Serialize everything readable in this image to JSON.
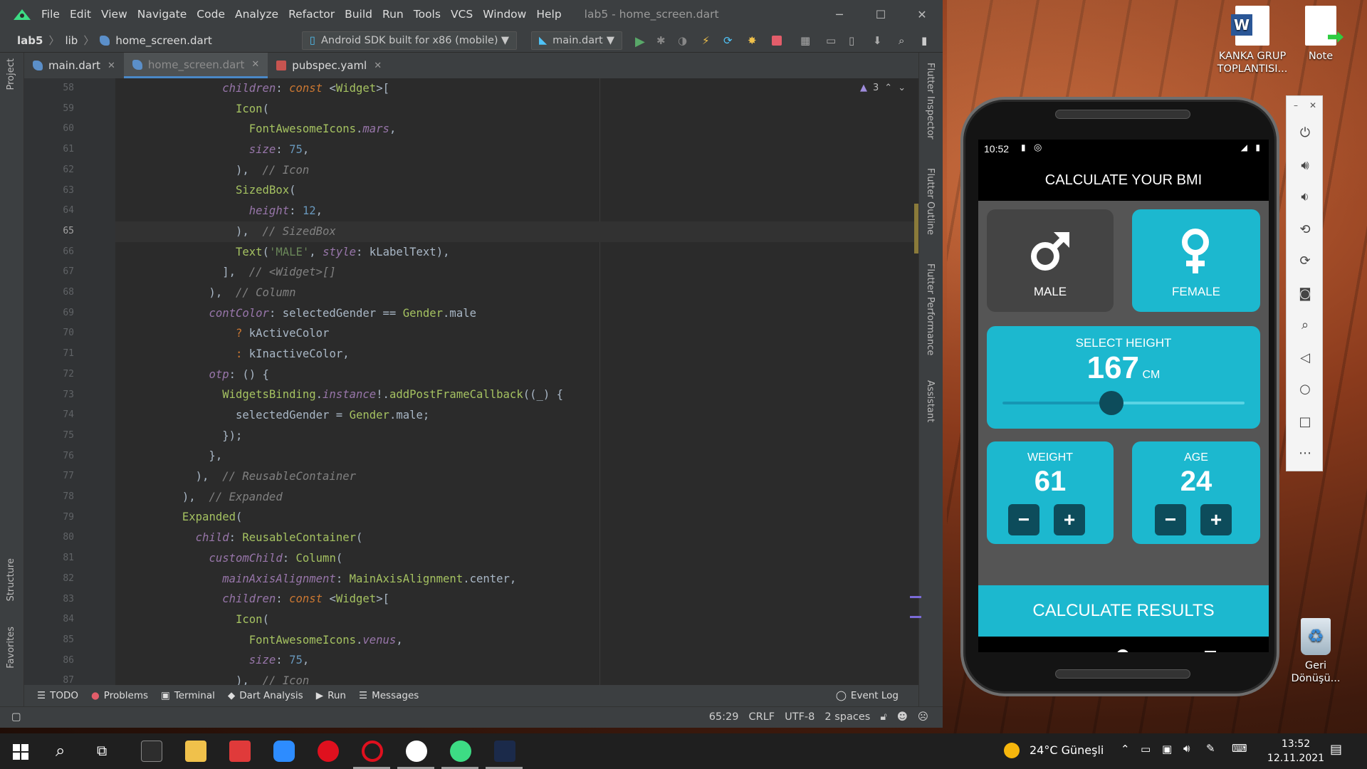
{
  "ide": {
    "menu": [
      "File",
      "Edit",
      "View",
      "Navigate",
      "Code",
      "Analyze",
      "Refactor",
      "Build",
      "Run",
      "Tools",
      "VCS",
      "Window",
      "Help"
    ],
    "window_title": "lab5 - home_screen.dart",
    "breadcrumb": [
      "lab5",
      "lib",
      "home_screen.dart"
    ],
    "device": "Android SDK built for x86 (mobile)",
    "run_config": "main.dart",
    "tabs": [
      {
        "label": "main.dart",
        "active": false
      },
      {
        "label": "home_screen.dart",
        "active": true
      },
      {
        "label": "pubspec.yaml",
        "active": false
      }
    ],
    "left_tabs": [
      "Project",
      "Structure",
      "Favorites"
    ],
    "right_tabs": [
      "Flutter Inspector",
      "Flutter Outline",
      "Flutter Performance",
      "Assistant"
    ],
    "warnings_count": "3",
    "line_numbers": [
      "58",
      "59",
      "60",
      "61",
      "62",
      "63",
      "64",
      "65",
      "66",
      "67",
      "68",
      "69",
      "70",
      "71",
      "72",
      "73",
      "74",
      "75",
      "76",
      "77",
      "78",
      "79",
      "80",
      "81",
      "82",
      "83",
      "84",
      "85",
      "86",
      "87"
    ],
    "current_line": "65",
    "bottom_tools": [
      "TODO",
      "Problems",
      "Terminal",
      "Dart Analysis",
      "Run",
      "Messages"
    ],
    "event_log": "Event Log",
    "status": {
      "position": "65:29",
      "line_sep": "CRLF",
      "encoding": "UTF-8",
      "indent": "2 spaces"
    }
  },
  "desktop": {
    "icons": [
      {
        "label": "KANKA GRUP TOPLANTISI...",
        "icon": "word-doc-icon"
      },
      {
        "label": "Note",
        "icon": "note-icon"
      },
      {
        "label": "Geri Dönüşü...",
        "icon": "recycle-bin-icon"
      }
    ]
  },
  "phone": {
    "time": "10:52",
    "app_title": "CALCULATE YOUR BMI",
    "male_label": "MALE",
    "female_label": "FEMALE",
    "height_label": "SELECT HEIGHT",
    "height_value": "167",
    "height_unit": "CM",
    "height_slider_fraction": 0.45,
    "weight_label": "WEIGHT",
    "weight_value": "61",
    "age_label": "AGE",
    "age_value": "24",
    "calc_label": "CALCULATE RESULTS",
    "colors": {
      "active": "#1cb8cf",
      "inactive": "#444444",
      "button": "#0d4c5b"
    }
  },
  "taskbar": {
    "weather": "24°C Güneşli",
    "time": "13:52",
    "date": "12.11.2021"
  }
}
